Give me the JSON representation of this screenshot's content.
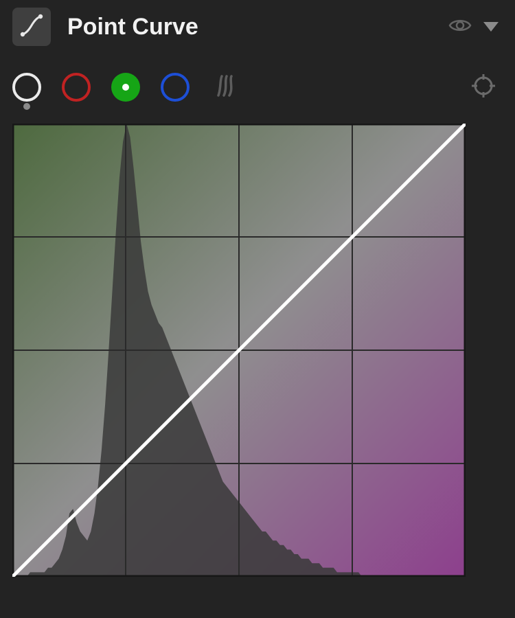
{
  "header": {
    "title": "Point Curve"
  },
  "icons": {
    "curve": "curve-icon",
    "eye": "eye-icon",
    "dropdown": "dropdown-icon",
    "swirl": "refine-swirl-icon",
    "target": "target-adjust-icon"
  },
  "channels": {
    "rgb": {
      "label": "rgb-channel",
      "color": "#eaeaea",
      "selected": false
    },
    "red": {
      "label": "red-channel",
      "color": "#c02222",
      "selected": false
    },
    "green": {
      "label": "green-channel",
      "color": "#16a516",
      "selected": true
    },
    "blue": {
      "label": "blue-channel",
      "color": "#1d4fd6",
      "selected": false
    }
  },
  "curve_graph": {
    "grid_divisions": 4,
    "gradient": {
      "from": "#4e6a3f",
      "to": "#8d3f8d"
    },
    "curve_line": {
      "x1": 0,
      "y1": 1,
      "x2": 1,
      "y2": 0
    },
    "histogram": [
      0.0,
      0.0,
      0.0,
      0.0,
      0.0,
      0.01,
      0.01,
      0.01,
      0.01,
      0.01,
      0.02,
      0.02,
      0.03,
      0.04,
      0.06,
      0.09,
      0.14,
      0.15,
      0.12,
      0.1,
      0.09,
      0.08,
      0.1,
      0.14,
      0.2,
      0.28,
      0.38,
      0.5,
      0.63,
      0.76,
      0.88,
      0.96,
      1.0,
      0.97,
      0.9,
      0.82,
      0.74,
      0.68,
      0.63,
      0.6,
      0.58,
      0.56,
      0.55,
      0.53,
      0.51,
      0.49,
      0.47,
      0.45,
      0.43,
      0.41,
      0.39,
      0.37,
      0.35,
      0.33,
      0.31,
      0.29,
      0.27,
      0.25,
      0.23,
      0.21,
      0.2,
      0.19,
      0.18,
      0.17,
      0.16,
      0.15,
      0.14,
      0.13,
      0.12,
      0.11,
      0.1,
      0.1,
      0.09,
      0.08,
      0.08,
      0.07,
      0.07,
      0.06,
      0.06,
      0.05,
      0.05,
      0.04,
      0.04,
      0.04,
      0.03,
      0.03,
      0.03,
      0.02,
      0.02,
      0.02,
      0.02,
      0.01,
      0.01,
      0.01,
      0.01,
      0.01,
      0.01,
      0.01,
      0.0,
      0.0,
      0.0,
      0.0,
      0.0,
      0.0,
      0.0,
      0.0,
      0.0,
      0.0,
      0.0,
      0.0,
      0.0,
      0.0,
      0.0,
      0.0,
      0.0,
      0.0,
      0.0,
      0.0,
      0.0,
      0.0,
      0.0,
      0.0,
      0.0,
      0.0,
      0.0,
      0.0,
      0.0,
      0.0
    ]
  }
}
